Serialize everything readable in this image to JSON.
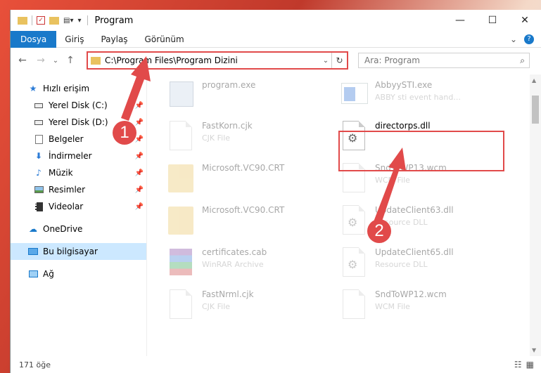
{
  "window": {
    "title": "Program"
  },
  "ribbon": {
    "tabs": [
      "Dosya",
      "Giriş",
      "Paylaş",
      "Görünüm"
    ],
    "active_tab": "Dosya"
  },
  "address": {
    "path": "C:\\Program Files\\Program Dizini",
    "search_placeholder": "Ara: Program"
  },
  "nav": {
    "quick_access": "Hızlı erişim",
    "items": [
      {
        "label": "Yerel Disk (C:)",
        "icon": "drive-icon"
      },
      {
        "label": "Yerel Disk (D:)",
        "icon": "drive-icon"
      },
      {
        "label": "Belgeler",
        "icon": "documents-icon"
      },
      {
        "label": "İndirmeler",
        "icon": "download-icon"
      },
      {
        "label": "Müzik",
        "icon": "music-icon"
      },
      {
        "label": "Resimler",
        "icon": "pictures-icon"
      },
      {
        "label": "Videolar",
        "icon": "videos-icon"
      }
    ],
    "onedrive": "OneDrive",
    "this_pc": "Bu bilgisayar",
    "network": "Ağ"
  },
  "files": [
    {
      "name": "program.exe",
      "type": "",
      "thumb": "exe",
      "faded": true
    },
    {
      "name": "AbbyySTI.exe",
      "type": "ABBY sti event hand...",
      "thumb": "win",
      "faded": true
    },
    {
      "name": "FastKorn.cjk",
      "type": "CJK File",
      "thumb": "doc",
      "faded": true
    },
    {
      "name": "directorps.dll",
      "type": "",
      "thumb": "dll",
      "faded": false
    },
    {
      "name": "Microsoft.VC90.CRT",
      "type": "",
      "thumb": "folder",
      "faded": true
    },
    {
      "name": "SndToWP13.wcm",
      "type": "WCM File",
      "thumb": "doc",
      "faded": true
    },
    {
      "name": "Microsoft.VC90.CRT",
      "type": "",
      "thumb": "folder",
      "faded": true
    },
    {
      "name": "UpdateClient63.dll",
      "type": "Resource DLL",
      "thumb": "dll",
      "faded": true
    },
    {
      "name": "certificates.cab",
      "type": "WinRAR Archive",
      "thumb": "rar",
      "faded": true
    },
    {
      "name": "UpdateClient65.dll",
      "type": "Resource DLL",
      "thumb": "dll",
      "faded": true
    },
    {
      "name": "FastNrml.cjk",
      "type": "CJK File",
      "thumb": "doc",
      "faded": true
    },
    {
      "name": "SndToWP12.wcm",
      "type": "WCM File",
      "thumb": "doc",
      "faded": true
    }
  ],
  "status": {
    "count": "171 öğe"
  },
  "callouts": [
    "1",
    "2"
  ],
  "colors": {
    "accent": "#1979ca",
    "highlight": "#e14a4a",
    "selected_nav": "#cce8ff"
  }
}
